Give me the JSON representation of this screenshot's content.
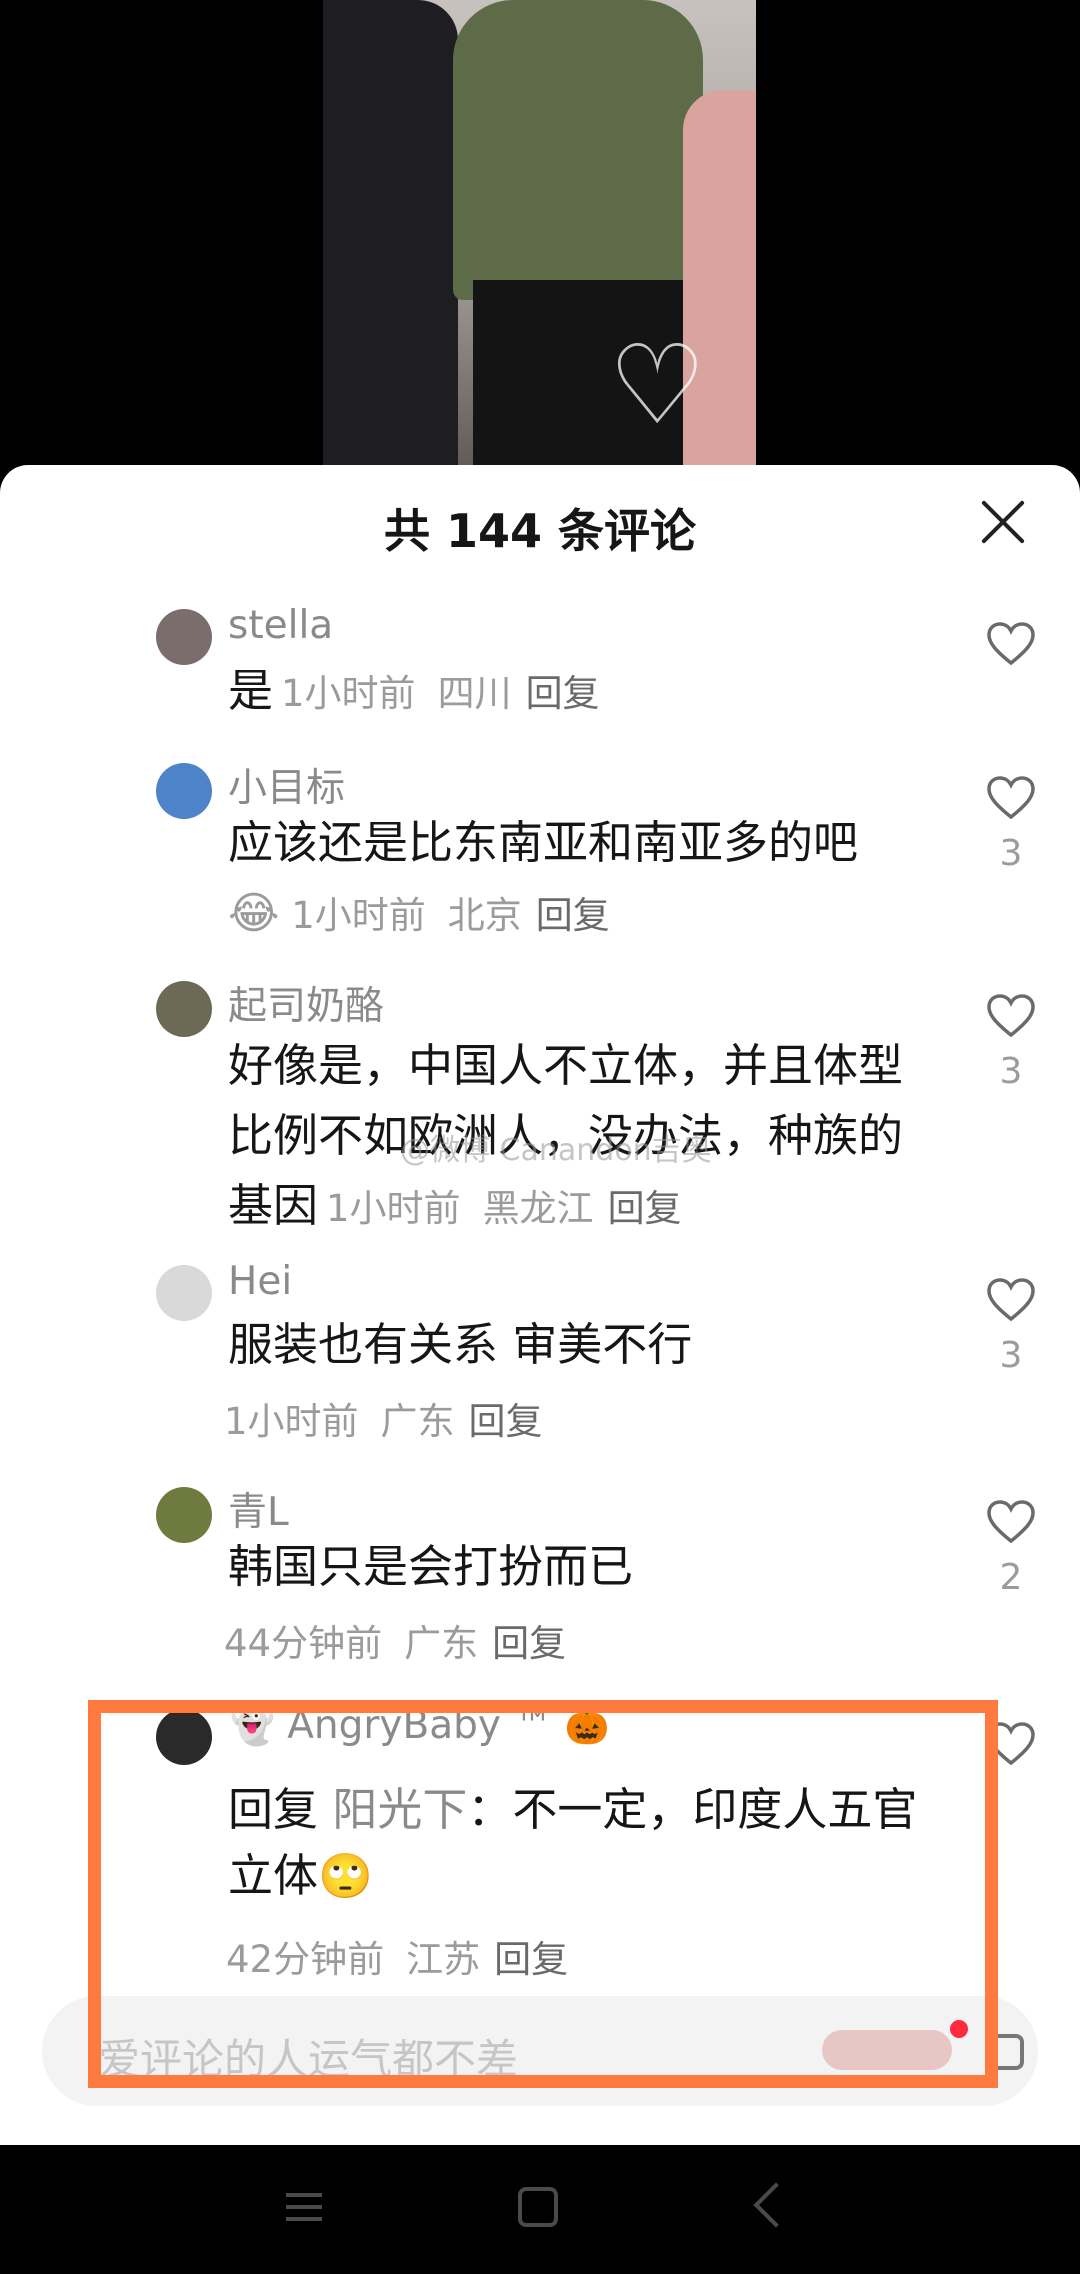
{
  "panel": {
    "title": "共 144 条评论"
  },
  "comments": [
    {
      "user": "stella",
      "text": "是",
      "time": "1小时前",
      "location": "四川",
      "reply": "回复",
      "likes": ""
    },
    {
      "user": "小目标",
      "text": "应该还是比东南亚和南亚多的吧",
      "time": "1小时前",
      "location": "北京",
      "reply": "回复",
      "likes": "3",
      "emoji": "😂"
    },
    {
      "user": "起司奶酪",
      "text": "好像是，中国人不立体，并且体型比例不如欧洲人，没办法，种族的基因",
      "time": "1小时前",
      "location": "黑龙江",
      "reply": "回复",
      "likes": "3"
    },
    {
      "user": "Hei",
      "text": "服装也有关系 审美不行",
      "time": "1小时前",
      "location": "广东",
      "reply": "回复",
      "likes": "3"
    },
    {
      "user": "青L",
      "text": "韩国只是会打扮而已",
      "time": "44分钟前",
      "location": "广东",
      "reply": "回复",
      "likes": "2"
    },
    {
      "user": "AngryBaby ™",
      "reply_prefix": "回复",
      "reply_to": "阳光下",
      "text": "：不一定，印度人五官立体",
      "time": "42分钟前",
      "location": "江苏",
      "reply": "回复",
      "likes": ""
    }
  ],
  "input": {
    "placeholder": "爱评论的人运气都不差"
  },
  "watermark": "@微博 Canandon吉奥"
}
